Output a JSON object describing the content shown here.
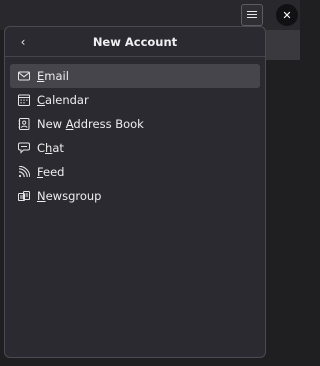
{
  "toolbar": {
    "menu_icon": "hamburger-menu-icon",
    "close_icon": "close-x-icon",
    "close_glyph": "✕"
  },
  "panel": {
    "back_glyph": "‹",
    "title": "New Account",
    "items": [
      {
        "key": "email",
        "pre": "",
        "accesskey": "E",
        "post": "mail",
        "icon": "envelope-icon",
        "active": true
      },
      {
        "key": "calendar",
        "pre": "",
        "accesskey": "C",
        "post": "alendar",
        "icon": "calendar-icon",
        "active": false
      },
      {
        "key": "address-book",
        "pre": "New ",
        "accesskey": "A",
        "post": "ddress Book",
        "icon": "address-book-icon",
        "active": false
      },
      {
        "key": "chat",
        "pre": "C",
        "accesskey": "h",
        "post": "at",
        "icon": "chat-bubble-icon",
        "active": false
      },
      {
        "key": "feed",
        "pre": "",
        "accesskey": "F",
        "post": "eed",
        "icon": "rss-feed-icon",
        "active": false
      },
      {
        "key": "newsgroup",
        "pre": "",
        "accesskey": "N",
        "post": "ewsgroup",
        "icon": "newsgroup-icon",
        "active": false
      }
    ]
  },
  "colors": {
    "panel_bg": "#2b2a30",
    "active_item_bg": "#45454b",
    "text": "#eeeef0"
  }
}
